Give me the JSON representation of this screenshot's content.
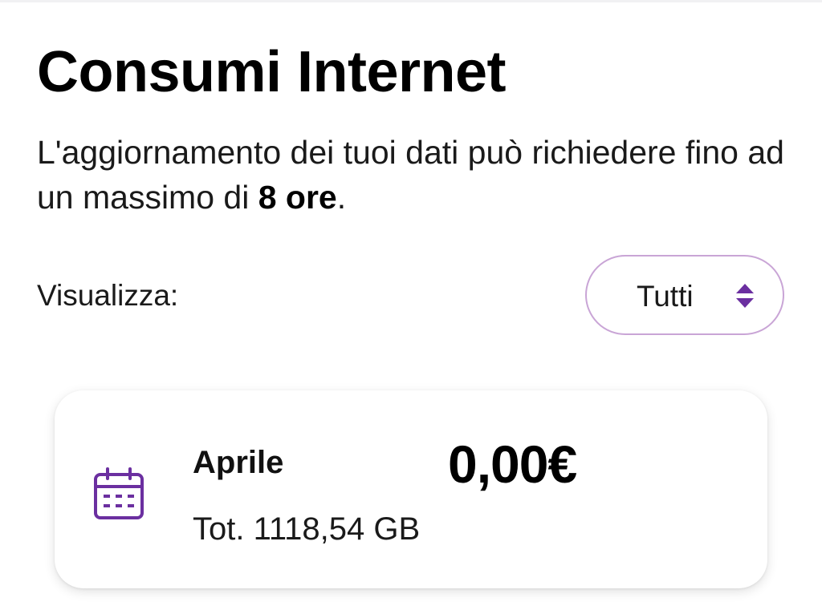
{
  "header": {
    "title": "Consumi Internet",
    "subtitle_prefix": "L'aggiornamento dei tuoi dati può richiedere fino ad un massimo di ",
    "subtitle_bold": "8 ore",
    "subtitle_suffix": "."
  },
  "filter": {
    "label": "Visualizza:",
    "selected": "Tutti",
    "icon": "sort-arrows-icon"
  },
  "usage_cards": [
    {
      "icon": "calendar-icon",
      "month": "Aprile",
      "amount": "0,00€",
      "total": "Tot. 1118,54 GB"
    }
  ],
  "colors": {
    "accent": "#6b2fa0",
    "select_border": "#c9a5d6",
    "text": "#1a1a1a"
  }
}
